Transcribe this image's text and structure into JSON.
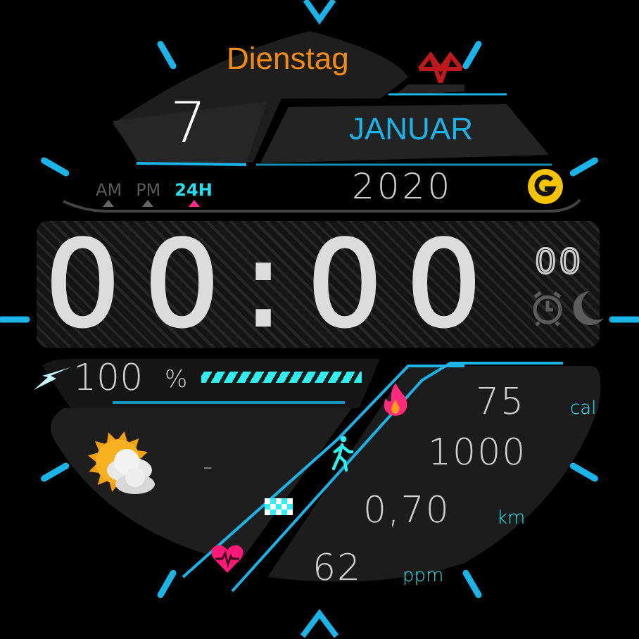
{
  "day_of_week": "Dienstag",
  "day": "7",
  "month": "JANUAR",
  "year": "2020",
  "time_formats": [
    {
      "label": "AM",
      "selected": false
    },
    {
      "label": "PM",
      "selected": false
    },
    {
      "label": "24H",
      "selected": true
    }
  ],
  "time": {
    "hours": "00",
    "separator": ":",
    "minutes": "00",
    "seconds": "00"
  },
  "battery": {
    "reading": "100",
    "unit": "%",
    "level": 1
  },
  "weather": {
    "temperature": "-"
  },
  "stats": [
    {
      "kind": "calories",
      "value": "75",
      "unit": "cal"
    },
    {
      "kind": "steps",
      "value": "1000"
    },
    {
      "kind": "distance",
      "value": "0,70",
      "unit": "km"
    },
    {
      "kind": "heart_rate",
      "value": "62",
      "unit": "ppm"
    }
  ]
}
